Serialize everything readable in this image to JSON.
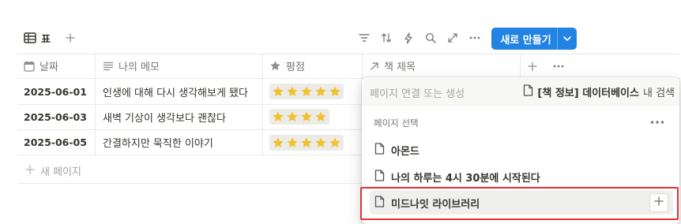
{
  "toolbar": {
    "view_label": "표",
    "view_icon": "table-icon",
    "add_view_icon": "plus-icon",
    "tools": [
      "filter-icon",
      "sort-icon",
      "lightning-icon",
      "search-icon",
      "expand-icon",
      "more-icon"
    ],
    "new_button_label": "새로 만들기",
    "new_button_color": "#2383e2"
  },
  "table": {
    "columns": [
      {
        "label": "날짜",
        "icon": "calendar-icon"
      },
      {
        "label": "나의 메모",
        "icon": "text-icon"
      },
      {
        "label": "평점",
        "icon": "star-icon"
      },
      {
        "label": "책 제목",
        "icon": "relation-arrow-icon"
      }
    ],
    "rows": [
      {
        "date": "2025-06-01",
        "memo": "인생에 대해 다시 생각해보게 됐다",
        "rating": 5
      },
      {
        "date": "2025-06-03",
        "memo": "새벽 기상이 생각보다 괜찮다",
        "rating": 4
      },
      {
        "date": "2025-06-05",
        "memo": "간결하지만 묵직한 이야기",
        "rating": 5
      }
    ],
    "new_page_label": "새 페이지",
    "star_color": "#f2c12e"
  },
  "popup": {
    "search_placeholder": "페이지 연결 또는 생성",
    "source_db": "[책 정보] 데이터베이스",
    "source_suffix": "내 검색",
    "section_title": "페이지 선택",
    "options": [
      {
        "label": "아몬드"
      },
      {
        "label": "나의 하루는 4시 30분에 시작된다"
      },
      {
        "label": "미드나잇 라이브러리"
      }
    ],
    "highlight_color": "#e03131"
  }
}
